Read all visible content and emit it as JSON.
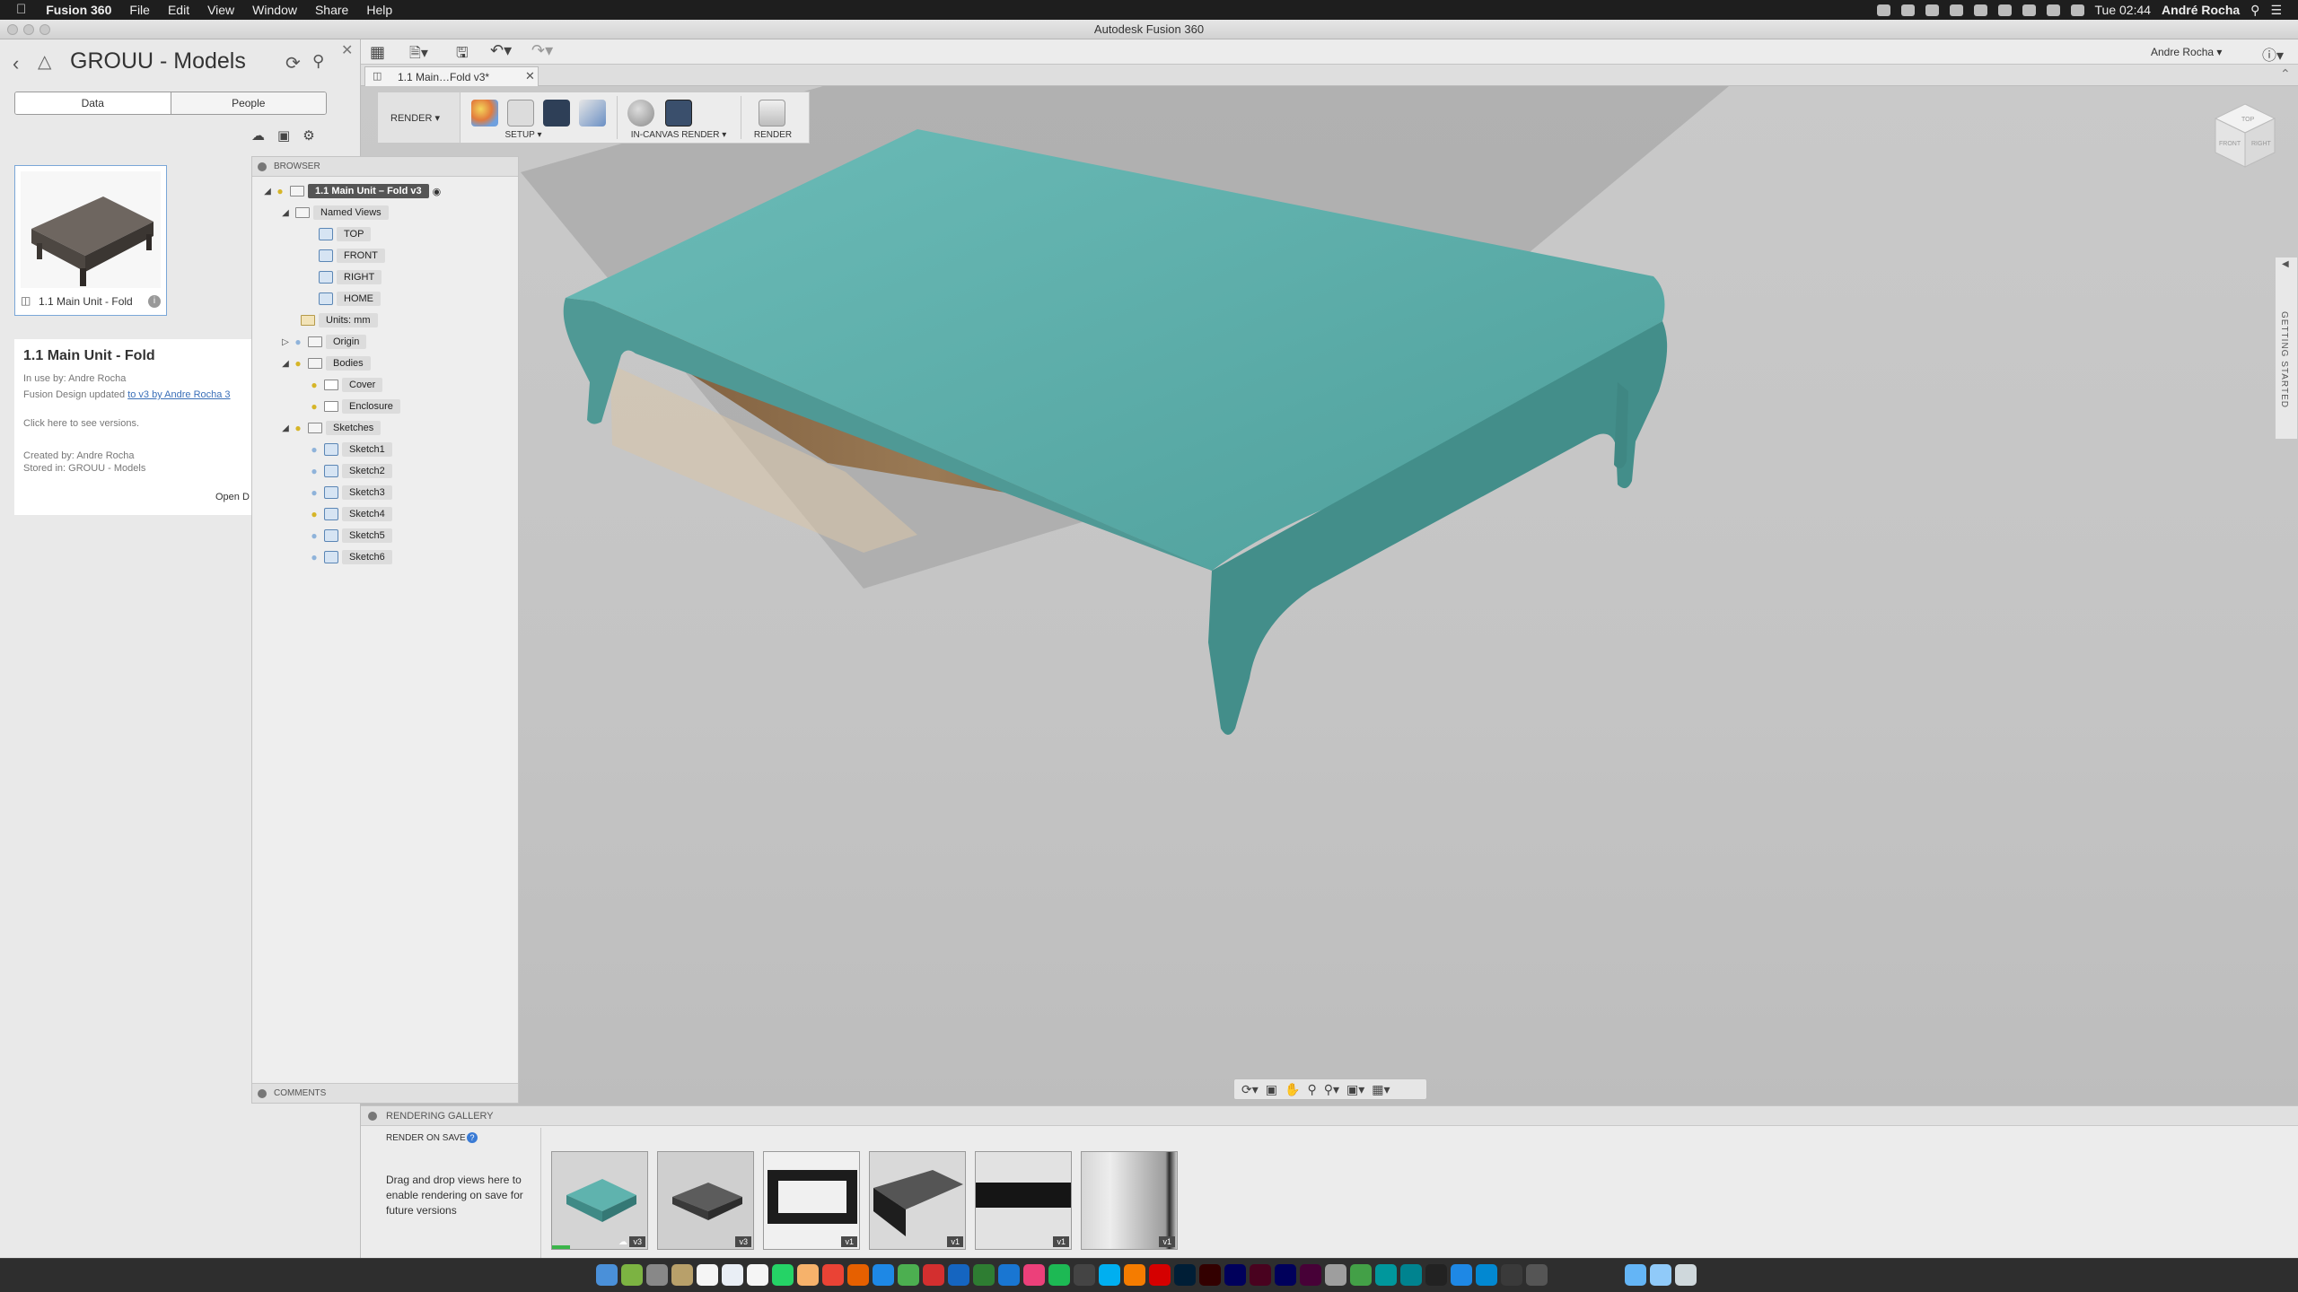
{
  "menubar": {
    "app_name": "Fusion 360",
    "items": [
      "File",
      "Edit",
      "View",
      "Window",
      "Share",
      "Help"
    ],
    "clock": "Tue 02:44",
    "user": "André Rocha"
  },
  "window": {
    "title": "Autodesk Fusion 360"
  },
  "data_panel": {
    "project_title": "GROUU - Models",
    "tabs": [
      "Data",
      "People"
    ],
    "active_tab": "Data",
    "card_label": "1.1 Main Unit - Fold",
    "details": {
      "name": "1.1 Main Unit - Fold",
      "in_use": "In use by: Andre Rocha",
      "update_prefix": "Fusion Design updated ",
      "update_link": "to v3 by Andre Rocha 3",
      "versions_hint": "Click here to see versions.",
      "created_by": "Created by: Andre Rocha",
      "stored_in": "Stored in: GROUU - Models",
      "open_label": "Open D"
    }
  },
  "toolbar": {
    "user_menu": "Andre Rocha",
    "help_icon": "?"
  },
  "doc_tab": {
    "label": "1.1 Main…Fold v3*"
  },
  "ribbon": {
    "workspace": "RENDER",
    "groups": [
      "SETUP",
      "IN-CANVAS RENDER",
      "RENDER"
    ]
  },
  "browser": {
    "title": "BROWSER",
    "root": "1.1 Main Unit – Fold v3",
    "named_views_label": "Named Views",
    "named_views": [
      "TOP",
      "FRONT",
      "RIGHT",
      "HOME"
    ],
    "units": "Units: mm",
    "origin": "Origin",
    "bodies_label": "Bodies",
    "bodies": [
      "Cover",
      "Enclosure"
    ],
    "sketches_label": "Sketches",
    "sketches": [
      "Sketch1",
      "Sketch2",
      "Sketch3",
      "Sketch4",
      "Sketch5",
      "Sketch6"
    ],
    "comments": "COMMENTS"
  },
  "viewcube": {
    "top": "TOP",
    "front": "FRONT",
    "right": "RIGHT"
  },
  "getting_started": "GETTING STARTED",
  "gallery": {
    "title": "RENDERING GALLERY",
    "render_on_save": "RENDER ON SAVE",
    "drop_hint": "Drag and drop views here to enable rendering on save for future versions",
    "thumbnails": [
      {
        "version": "v3",
        "style": "teal"
      },
      {
        "version": "v3",
        "style": "dark-table"
      },
      {
        "version": "v1",
        "style": "black-frame"
      },
      {
        "version": "v1",
        "style": "dark-slab"
      },
      {
        "version": "v1",
        "style": "dark-strip"
      },
      {
        "version": "v1",
        "style": "gray-panel"
      }
    ]
  },
  "colors": {
    "model_teal": "#5aafab",
    "model_wood": "#8a6a45",
    "viewport_bg": "#c6c6c6",
    "accent_blue": "#3a7bd5"
  }
}
